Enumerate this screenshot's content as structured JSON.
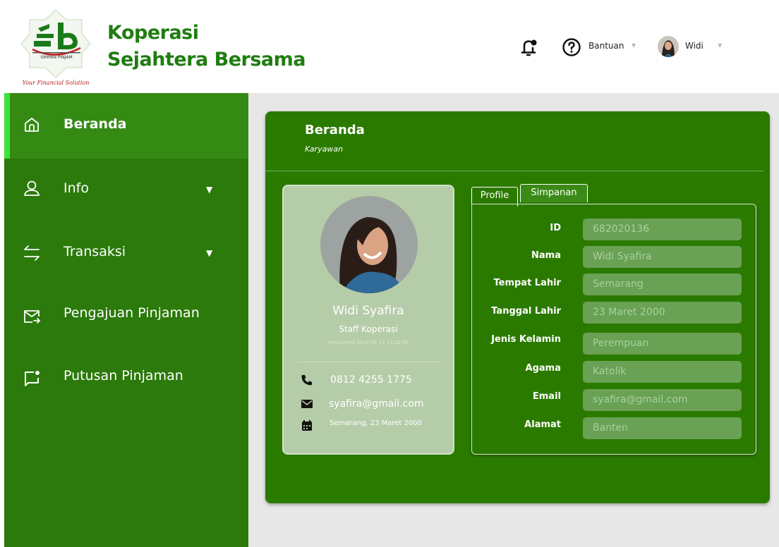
{
  "header": {
    "logo_text": "SIMPAN PINJAM",
    "logo_tagline": "Your Financial Solution",
    "brand_line1": "Koperasi",
    "brand_line2": "Sejahtera Bersama",
    "notification_icon": "bell-icon",
    "help_icon": "question-circle-icon",
    "help_label": "Bantuan",
    "user_label": "Widi"
  },
  "sidebar": {
    "items": [
      {
        "label": "Beranda",
        "icon": "home-icon",
        "active": true
      },
      {
        "label": "Info",
        "icon": "user-icon",
        "has_dropdown": true
      },
      {
        "label": "Transaksi",
        "icon": "swap-arrows-icon",
        "has_dropdown": true
      },
      {
        "label": "Pengajuan Pinjaman",
        "icon": "mail-forward-icon"
      },
      {
        "label": "Putusan Pinjaman",
        "icon": "chat-notification-icon"
      }
    ]
  },
  "main": {
    "title": "Beranda",
    "subtitle": "Karyawan",
    "profile_card": {
      "name": "Widi Syafira",
      "role": "Staff Koperasi",
      "registered": "Registered 2018-05-17 14:22:45",
      "phone": "0812 4255 1775",
      "email": "syafira@gmail.com",
      "birth": "Semarang, 23 Maret 2000"
    },
    "tabs": [
      {
        "label": "Profile",
        "active": true
      },
      {
        "label": "Simpanan",
        "active": false
      }
    ],
    "fields": [
      {
        "label": "ID",
        "value": "682020136"
      },
      {
        "label": "Nama",
        "value": "Widi Syafira"
      },
      {
        "label": "Tempat Lahir",
        "value": "Semarang"
      },
      {
        "label": "Tanggal Lahir",
        "value": "23 Maret 2000"
      },
      {
        "label": "Jenis Kelamin",
        "value": "Perempuan"
      },
      {
        "label": "Agama",
        "value": "Katolik"
      },
      {
        "label": "Email",
        "value": "syafira@gmail.com"
      },
      {
        "label": "Alamat",
        "value": "Banten"
      }
    ]
  },
  "colors": {
    "brand_green": "#1f7d10",
    "sidebar": "#2b7a0b",
    "sidebar_active": "#358a14",
    "active_indicator": "#3ce33c",
    "panel": "#2b7a00",
    "card": "#b5cca8",
    "field": "#69a155"
  }
}
